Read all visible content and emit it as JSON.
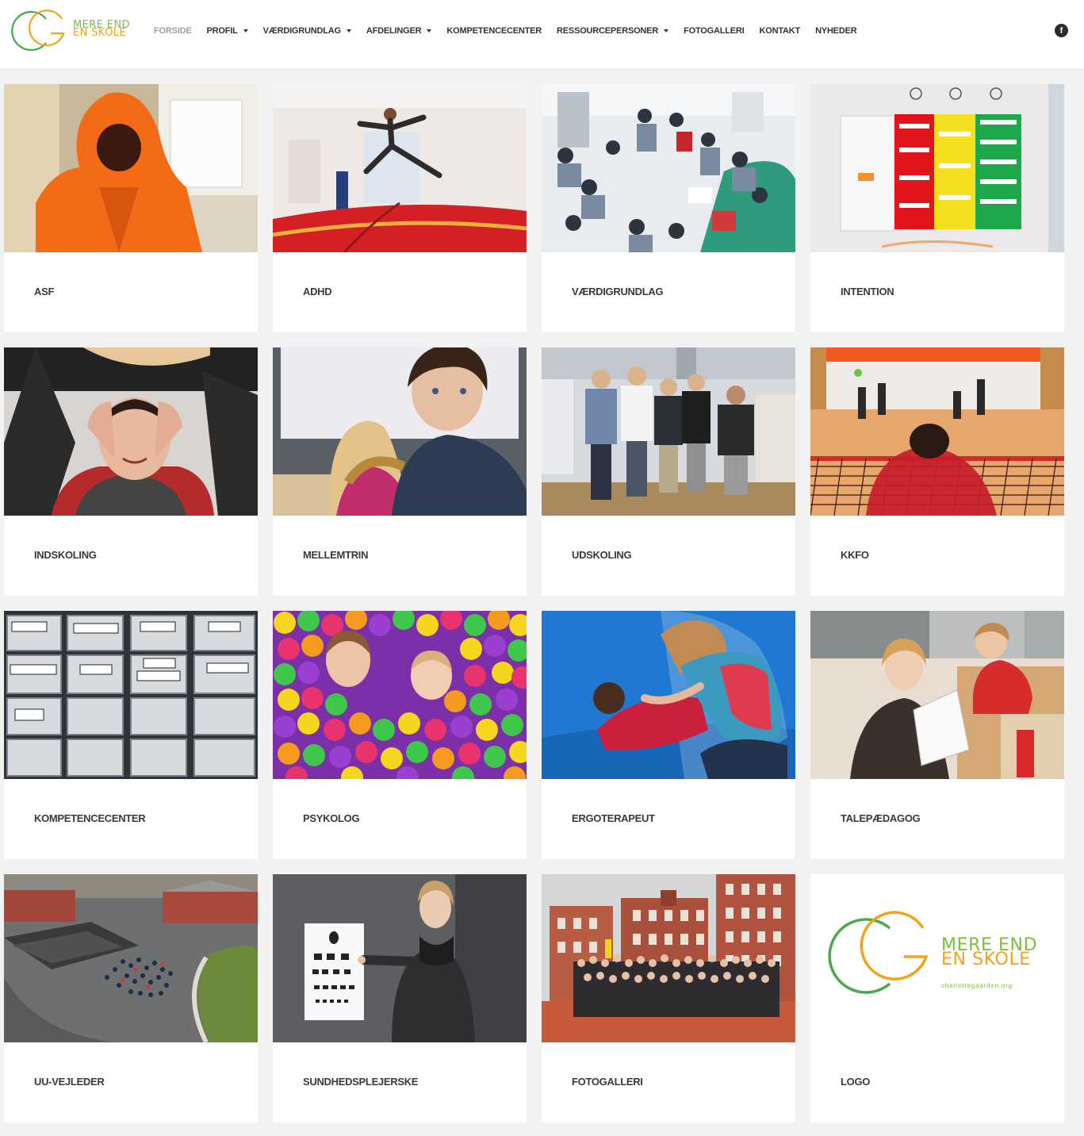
{
  "brand": {
    "line1": "MERE END",
    "line2": "EN SKOLE",
    "url": "charlottegaarden.org",
    "green": "#49a94a",
    "orange": "#f3a21a"
  },
  "nav": [
    {
      "label": "FORSIDE",
      "active": true,
      "dropdown": false
    },
    {
      "label": "PROFIL",
      "active": false,
      "dropdown": true
    },
    {
      "label": "VÆRDIGRUNDLAG",
      "active": false,
      "dropdown": true
    },
    {
      "label": "AFDELINGER",
      "active": false,
      "dropdown": true
    },
    {
      "label": "KOMPETENCECENTER",
      "active": false,
      "dropdown": false
    },
    {
      "label": "RESSOURCEPERSONER",
      "active": false,
      "dropdown": true
    },
    {
      "label": "FOTOGALLERI",
      "active": false,
      "dropdown": false
    },
    {
      "label": "KONTAKT",
      "active": false,
      "dropdown": false
    },
    {
      "label": "NYHEDER",
      "active": false,
      "dropdown": false
    }
  ],
  "social": {
    "facebook_glyph": "f",
    "icon": "facebook-icon"
  },
  "cards": [
    {
      "label": "ASF"
    },
    {
      "label": "ADHD"
    },
    {
      "label": "VÆRDIGRUNDLAG"
    },
    {
      "label": "INTENTION"
    },
    {
      "label": "INDSKOLING"
    },
    {
      "label": "MELLEMTRIN"
    },
    {
      "label": "UDSKOLING"
    },
    {
      "label": "KKFO"
    },
    {
      "label": "KOMPETENCECENTER"
    },
    {
      "label": "PSYKOLOG"
    },
    {
      "label": "ERGOTERAPEUT"
    },
    {
      "label": "TALEPÆDAGOG"
    },
    {
      "label": "UU-VEJLEDER"
    },
    {
      "label": "SUNDHEDSPLEJERSKE"
    },
    {
      "label": "FOTOGALLERI"
    },
    {
      "label": "LOGO"
    }
  ]
}
